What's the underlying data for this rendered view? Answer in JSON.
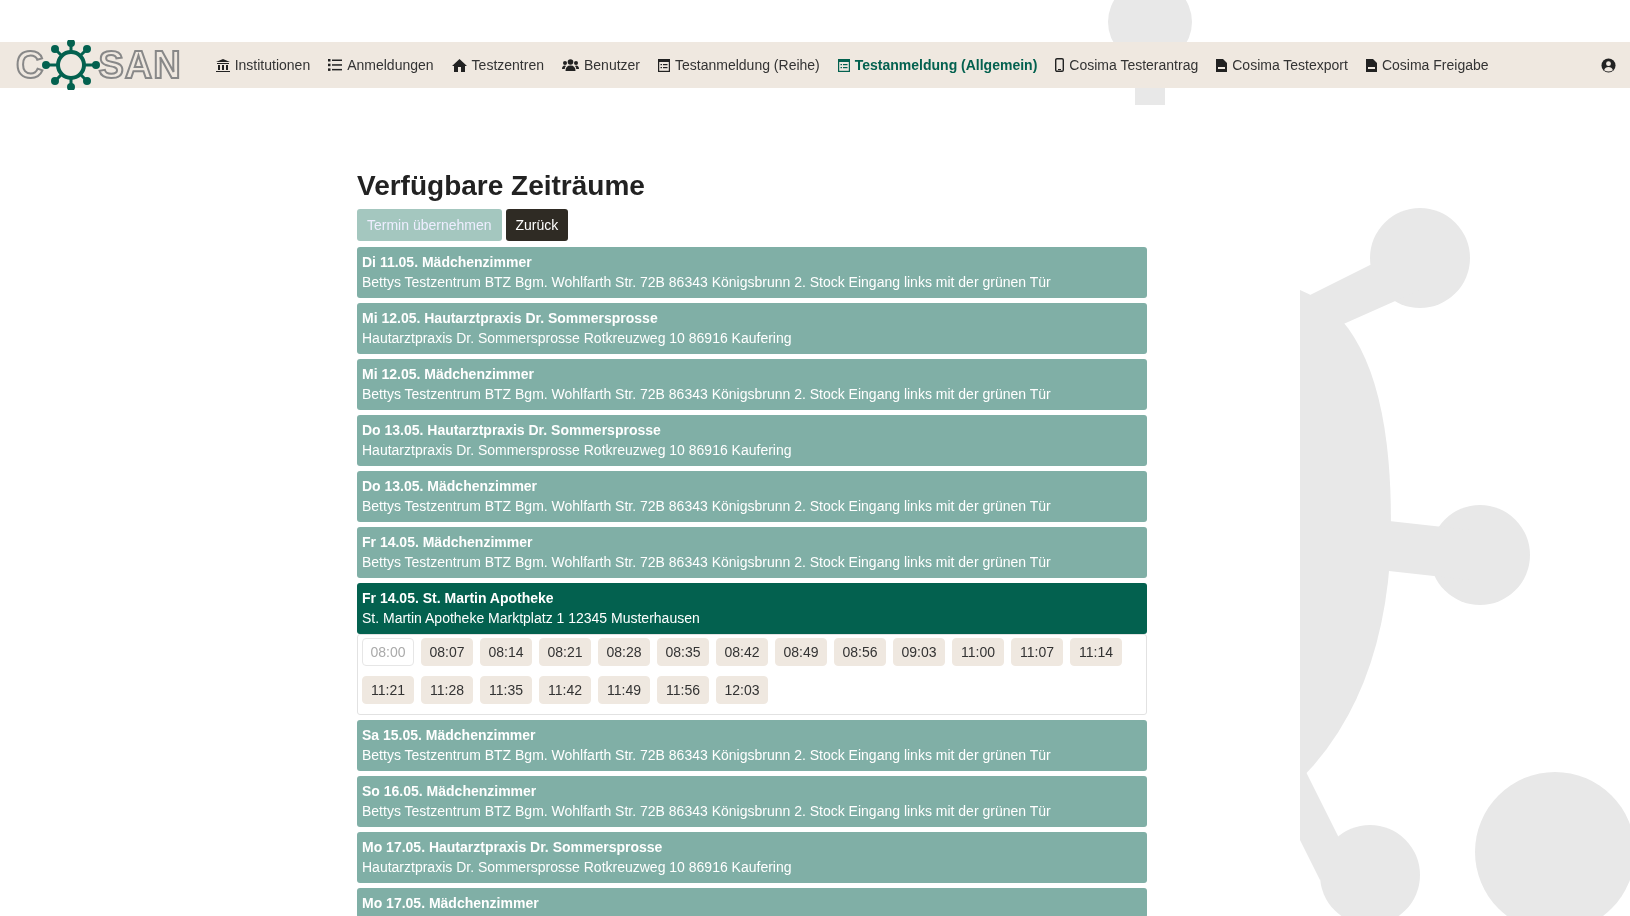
{
  "nav": {
    "logo": "C SAN",
    "items": [
      {
        "label": "Institutionen",
        "selected": false
      },
      {
        "label": "Anmeldungen",
        "selected": false
      },
      {
        "label": "Testzentren",
        "selected": false
      },
      {
        "label": "Benutzer",
        "selected": false
      },
      {
        "label": "Testanmeldung (Reihe)",
        "selected": false
      },
      {
        "label": "Testanmeldung (Allgemein)",
        "selected": true
      },
      {
        "label": "Cosima Testerantrag",
        "selected": false
      },
      {
        "label": "Cosima Testexport",
        "selected": false
      },
      {
        "label": "Cosima Freigabe",
        "selected": false
      }
    ]
  },
  "heading": "Verfügbare Zeiträume",
  "buttons": [
    {
      "label": "Termin übernehmen",
      "disabled": true
    },
    {
      "label": "Zurück",
      "disabled": false
    }
  ],
  "slots_list": [
    {
      "title": "Di 11.05. Mädchenzimmer",
      "address": "Bettys Testzentrum BTZ Bgm. Wohlfarth Str. 72B 86343 Königsbrunn 2. Stock Eingang links mit der grünen Tür",
      "selected": false
    },
    {
      "title": "Mi 12.05. Hautarztpraxis Dr. Sommersprosse",
      "address": "Hautarztpraxis Dr. Sommersprosse Rotkreuzweg 10 86916 Kaufering",
      "selected": false
    },
    {
      "title": "Mi 12.05. Mädchenzimmer",
      "address": "Bettys Testzentrum BTZ Bgm. Wohlfarth Str. 72B 86343 Königsbrunn 2. Stock Eingang links mit der grünen Tür",
      "selected": false
    },
    {
      "title": "Do 13.05. Hautarztpraxis Dr. Sommersprosse",
      "address": "Hautarztpraxis Dr. Sommersprosse Rotkreuzweg 10 86916 Kaufering",
      "selected": false
    },
    {
      "title": "Do 13.05. Mädchenzimmer",
      "address": "Bettys Testzentrum BTZ Bgm. Wohlfarth Str. 72B 86343 Königsbrunn 2. Stock Eingang links mit der grünen Tür",
      "selected": false
    },
    {
      "title": "Fr 14.05. Mädchenzimmer",
      "address": "Bettys Testzentrum BTZ Bgm. Wohlfarth Str. 72B 86343 Königsbrunn 2. Stock Eingang links mit der grünen Tür",
      "selected": false
    },
    {
      "title": "Fr 14.05. St. Martin Apotheke",
      "address": "St. Martin Apotheke Marktplatz 1 12345 Musterhausen",
      "selected": true,
      "times": [
        {
          "label": "08:00",
          "disabled": true
        },
        {
          "label": "08:07",
          "disabled": false
        },
        {
          "label": "08:14",
          "disabled": false
        },
        {
          "label": "08:21",
          "disabled": false
        },
        {
          "label": "08:28",
          "disabled": false
        },
        {
          "label": "08:35",
          "disabled": false
        },
        {
          "label": "08:42",
          "disabled": false
        },
        {
          "label": "08:49",
          "disabled": false
        },
        {
          "label": "08:56",
          "disabled": false
        },
        {
          "label": "09:03",
          "disabled": false
        },
        {
          "label": "11:00",
          "disabled": false
        },
        {
          "label": "11:07",
          "disabled": false
        },
        {
          "label": "11:14",
          "disabled": false
        },
        {
          "label": "11:21",
          "disabled": false
        },
        {
          "label": "11:28",
          "disabled": false
        },
        {
          "label": "11:35",
          "disabled": false
        },
        {
          "label": "11:42",
          "disabled": false
        },
        {
          "label": "11:49",
          "disabled": false
        },
        {
          "label": "11:56",
          "disabled": false
        },
        {
          "label": "12:03",
          "disabled": false
        }
      ]
    },
    {
      "title": "Sa 15.05. Mädchenzimmer",
      "address": "Bettys Testzentrum BTZ Bgm. Wohlfarth Str. 72B 86343 Königsbrunn 2. Stock Eingang links mit der grünen Tür",
      "selected": false
    },
    {
      "title": "So 16.05. Mädchenzimmer",
      "address": "Bettys Testzentrum BTZ Bgm. Wohlfarth Str. 72B 86343 Königsbrunn 2. Stock Eingang links mit der grünen Tür",
      "selected": false
    },
    {
      "title": "Mo 17.05. Hautarztpraxis Dr. Sommersprosse",
      "address": "Hautarztpraxis Dr. Sommersprosse Rotkreuzweg 10 86916 Kaufering",
      "selected": false
    },
    {
      "title": "Mo 17.05. Mädchenzimmer",
      "selected": false
    }
  ]
}
